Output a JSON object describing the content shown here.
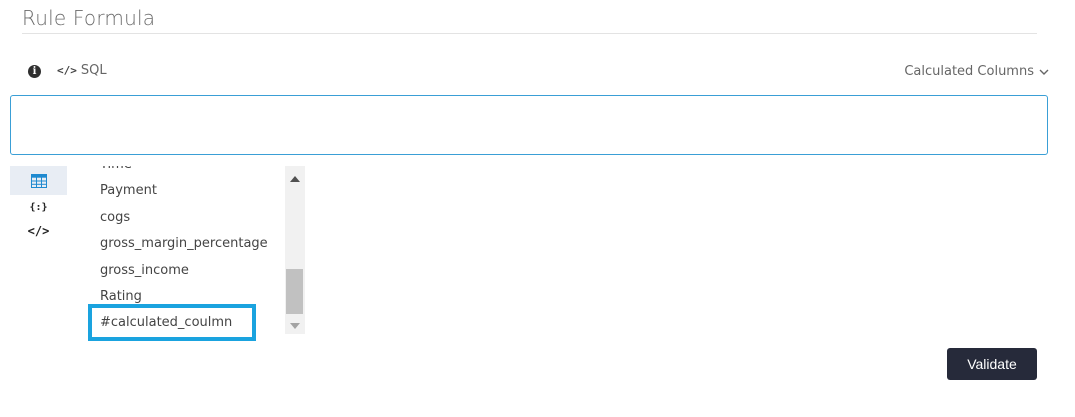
{
  "header": {
    "title": "Rule Formula"
  },
  "toolbar": {
    "info_icon": "info-circle",
    "sql_icon": "code",
    "sql_label": "SQL",
    "calculated_columns_label": "Calculated Columns"
  },
  "formula": {
    "value": ""
  },
  "side_tabs": [
    {
      "icon": "table-icon",
      "active": true
    },
    {
      "icon": "braces-icon",
      "active": false
    },
    {
      "icon": "code-icon",
      "active": false
    }
  ],
  "column_list": {
    "items": [
      {
        "label": "Time"
      },
      {
        "label": "Payment"
      },
      {
        "label": "cogs"
      },
      {
        "label": "gross_margin_percentage"
      },
      {
        "label": "gross_income"
      },
      {
        "label": "Rating"
      },
      {
        "label": "#calculated_coulmn"
      }
    ],
    "highlighted_item": "#calculated_coulmn"
  },
  "actions": {
    "validate_label": "Validate"
  },
  "colors": {
    "accent_border": "#3a9fd6",
    "highlight": "#1aa3df",
    "button_bg": "#262a3a",
    "active_tab_bg": "#e8edf4"
  }
}
